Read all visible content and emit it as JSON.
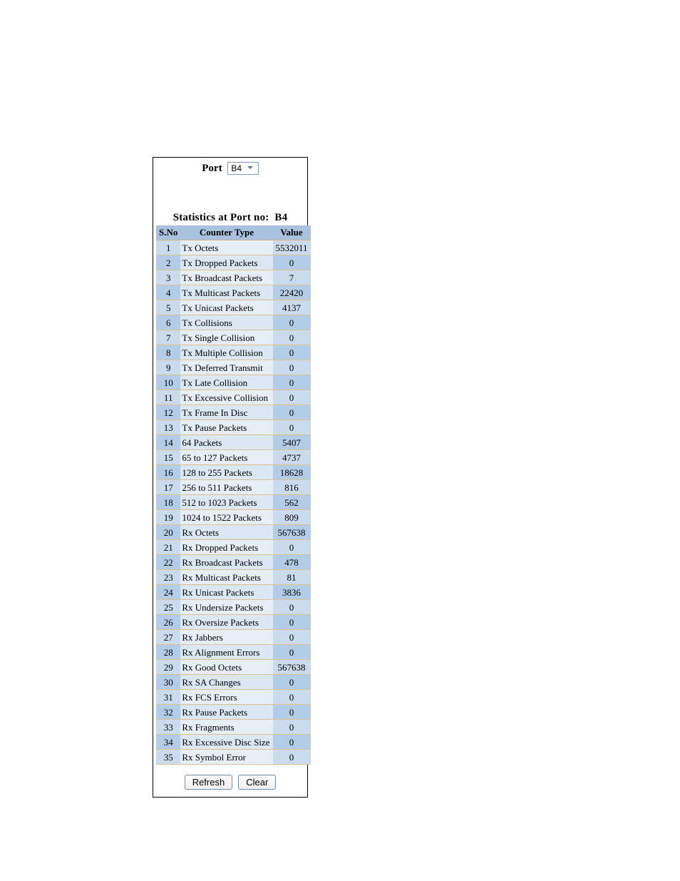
{
  "port_selector": {
    "label": "Port",
    "selected": "B4"
  },
  "statistics": {
    "title_prefix": "Statistics at Port no:",
    "port": "B4",
    "columns": {
      "sno": "S.No",
      "type": "Counter Type",
      "value": "Value"
    },
    "rows": [
      {
        "sno": "1",
        "type": "Tx Octets",
        "value": "5532011"
      },
      {
        "sno": "2",
        "type": "Tx Dropped Packets",
        "value": "0"
      },
      {
        "sno": "3",
        "type": "Tx Broadcast Packets",
        "value": "7"
      },
      {
        "sno": "4",
        "type": "Tx Multicast Packets",
        "value": "22420"
      },
      {
        "sno": "5",
        "type": "Tx Unicast Packets",
        "value": "4137"
      },
      {
        "sno": "6",
        "type": "Tx Collisions",
        "value": "0"
      },
      {
        "sno": "7",
        "type": "Tx Single Collision",
        "value": "0"
      },
      {
        "sno": "8",
        "type": "Tx Multiple Collision",
        "value": "0"
      },
      {
        "sno": "9",
        "type": "Tx Deferred Transmit",
        "value": "0"
      },
      {
        "sno": "10",
        "type": "Tx Late Collision",
        "value": "0"
      },
      {
        "sno": "11",
        "type": "Tx Excessive Collision",
        "value": "0"
      },
      {
        "sno": "12",
        "type": "Tx Frame In Disc",
        "value": "0"
      },
      {
        "sno": "13",
        "type": "Tx Pause Packets",
        "value": "0"
      },
      {
        "sno": "14",
        "type": "64 Packets",
        "value": "5407"
      },
      {
        "sno": "15",
        "type": "65 to 127 Packets",
        "value": "4737"
      },
      {
        "sno": "16",
        "type": "128 to 255 Packets",
        "value": "18628"
      },
      {
        "sno": "17",
        "type": "256 to 511 Packets",
        "value": "816"
      },
      {
        "sno": "18",
        "type": "512 to 1023 Packets",
        "value": "562"
      },
      {
        "sno": "19",
        "type": "1024 to 1522 Packets",
        "value": "809"
      },
      {
        "sno": "20",
        "type": "Rx Octets",
        "value": "567638"
      },
      {
        "sno": "21",
        "type": "Rx Dropped Packets",
        "value": "0"
      },
      {
        "sno": "22",
        "type": "Rx Broadcast Packets",
        "value": "478"
      },
      {
        "sno": "23",
        "type": "Rx Multicast Packets",
        "value": "81"
      },
      {
        "sno": "24",
        "type": "Rx Unicast Packets",
        "value": "3836"
      },
      {
        "sno": "25",
        "type": "Rx Undersize Packets",
        "value": "0"
      },
      {
        "sno": "26",
        "type": "Rx Oversize Packets",
        "value": "0"
      },
      {
        "sno": "27",
        "type": "Rx Jabbers",
        "value": "0"
      },
      {
        "sno": "28",
        "type": "Rx Alignment Errors",
        "value": "0"
      },
      {
        "sno": "29",
        "type": "Rx Good Octets",
        "value": "567638"
      },
      {
        "sno": "30",
        "type": "Rx SA Changes",
        "value": "0"
      },
      {
        "sno": "31",
        "type": "Rx FCS Errors",
        "value": "0"
      },
      {
        "sno": "32",
        "type": "Rx Pause Packets",
        "value": "0"
      },
      {
        "sno": "33",
        "type": "Rx Fragments",
        "value": "0"
      },
      {
        "sno": "34",
        "type": "Rx Excessive Disc Size",
        "value": "0"
      },
      {
        "sno": "35",
        "type": "Rx Symbol Error",
        "value": "0"
      }
    ]
  },
  "buttons": {
    "refresh": "Refresh",
    "clear": "Clear"
  }
}
